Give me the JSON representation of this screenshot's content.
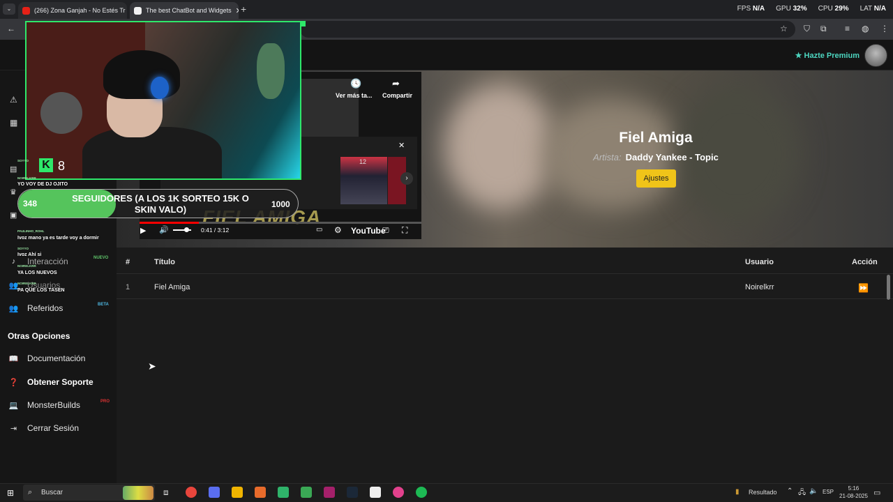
{
  "browser": {
    "tabs": [
      {
        "title": "(266) Zona Ganjah - No Estés Tr",
        "favicon_color": "#e62117"
      },
      {
        "title": "The best ChatBot and Widgets",
        "favicon_color": "#f1f1f1"
      }
    ],
    "overlay_stats": {
      "fps_label": "FPS",
      "fps_value": "N/A",
      "gpu_label": "GPU",
      "gpu_value": "32",
      "cpu_label": "CPU",
      "cpu_value": "29",
      "lat_label": "LAT",
      "lat_value": "N/A",
      "percent_sign": "%"
    }
  },
  "header": {
    "premium_label": "Hazte Premium"
  },
  "sidebar": {
    "items": [
      {
        "label": "Interacción",
        "icon": "music-icon",
        "badge": "NUEVO"
      },
      {
        "label": "Usuarios",
        "icon": "users-icon",
        "badge": ""
      },
      {
        "label": "Referidos",
        "icon": "users-icon",
        "badge": "BETA"
      }
    ],
    "other_title": "Otras Opciones",
    "other_items": [
      {
        "label": "Documentación",
        "icon": "book-icon",
        "badge": ""
      },
      {
        "label": "Obtener Soporte",
        "icon": "help-icon",
        "badge": ""
      },
      {
        "label": "MonsterBuilds",
        "icon": "laptop-icon",
        "badge": "PRO"
      },
      {
        "label": "Cerrar Sesión",
        "icon": "logout-icon",
        "badge": ""
      }
    ]
  },
  "now_playing": {
    "title": "Fiel Amiga",
    "artist_label": "Artista:",
    "artist": "Daddy Yankee - Topic",
    "settings_button": "Ajustes"
  },
  "youtube": {
    "watch_later": "Ver más ta...",
    "share": "Compartir",
    "time": "0:41 / 3:12",
    "progress": 0.21,
    "brand": "YouTube",
    "banner_text": "FIEL AMIGA",
    "thumb_number": "12"
  },
  "stream": {
    "viewer_count": "8",
    "goal": {
      "current": "348",
      "max": "1000",
      "text": "SEGUIDORES (A LOS 1K SORTEO 15K O SKIN VALO)",
      "fraction": 0.348
    },
    "chat": [
      {
        "user": "SOYYO",
        "message": "YO VOY DE DJ OJITO"
      },
      {
        "user": "NOIRELKRR",
        "message": ""
      },
      {
        "user": "PAULINHO_ROHL",
        "message": "Ivoz mano ya es tarde voy a dormir"
      },
      {
        "user": "SOYYO",
        "message": "Ivoz Ahí si"
      },
      {
        "user": "NOIRELKRR",
        "message": "YA LOS NUEVOS"
      },
      {
        "user": "NOIRELKRR",
        "message": "PA QUE LOS TASEN"
      }
    ]
  },
  "queue": {
    "headers": {
      "num": "#",
      "title": "Título",
      "user": "Usuario",
      "action": "Acción"
    },
    "rows": [
      {
        "num": "1",
        "title": "Fiel Amiga",
        "user": "Noirelkrr"
      }
    ]
  },
  "taskbar": {
    "search_placeholder": "Buscar",
    "tray_label": "Resultado",
    "lang": "ESP",
    "time": "5:16",
    "date": "21-08-2025",
    "app_colors": [
      "#e8453c",
      "#5a6ef0",
      "#f0b400",
      "#e86b2b",
      "#2fb36a",
      "#3aa855",
      "#a4206a",
      "#1b2838",
      "#eeeeee",
      "#e2418d",
      "#1db954"
    ]
  }
}
